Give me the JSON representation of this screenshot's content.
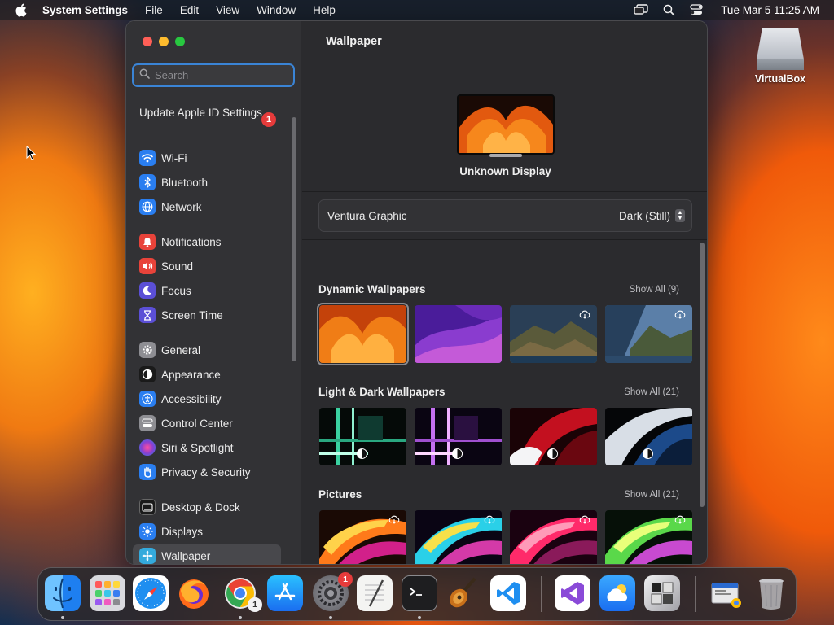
{
  "menubar": {
    "app_name": "System Settings",
    "menus": [
      "File",
      "Edit",
      "View",
      "Window",
      "Help"
    ],
    "clock": "Tue Mar 5  11:25 AM"
  },
  "desktop": {
    "icons": [
      {
        "label": "VirtualBox",
        "icon": "hard-drive-icon"
      }
    ]
  },
  "window": {
    "search": {
      "placeholder": "Search",
      "value": ""
    },
    "apple_id": {
      "label": "Update Apple ID Settings",
      "badge": "1"
    },
    "sidebar": {
      "items": [
        {
          "label": "Wi-Fi",
          "icon": "wifi-icon",
          "color": "#2a7ef0"
        },
        {
          "label": "Bluetooth",
          "icon": "bluetooth-icon",
          "color": "#2a7ef0"
        },
        {
          "label": "Network",
          "icon": "globe-icon",
          "color": "#2a7ef0"
        },
        {
          "label": "Notifications",
          "icon": "bell-icon",
          "color": "#e8433a"
        },
        {
          "label": "Sound",
          "icon": "speaker-icon",
          "color": "#e8433a"
        },
        {
          "label": "Focus",
          "icon": "moon-icon",
          "color": "#5b4fd6"
        },
        {
          "label": "Screen Time",
          "icon": "hourglass-icon",
          "color": "#5b4fd6"
        },
        {
          "label": "General",
          "icon": "gear-icon",
          "color": "#8e8e93"
        },
        {
          "label": "Appearance",
          "icon": "appearance-icon",
          "color": "#1a1a1a"
        },
        {
          "label": "Accessibility",
          "icon": "accessibility-icon",
          "color": "#2a7ef0"
        },
        {
          "label": "Control Center",
          "icon": "control-center-icon",
          "color": "#8e8e93"
        },
        {
          "label": "Siri & Spotlight",
          "icon": "siri-icon",
          "color": "#8a3fd0"
        },
        {
          "label": "Privacy & Security",
          "icon": "hand-icon",
          "color": "#2a7ef0"
        },
        {
          "label": "Desktop & Dock",
          "icon": "dock-icon",
          "color": "#1a1a1a"
        },
        {
          "label": "Displays",
          "icon": "sun-icon",
          "color": "#2a7ef0"
        },
        {
          "label": "Wallpaper",
          "icon": "wallpaper-icon",
          "color": "#34aadc",
          "selected": true
        }
      ]
    },
    "content": {
      "title": "Wallpaper",
      "display_name": "Unknown Display",
      "current_wallpaper": "Ventura Graphic",
      "appearance_mode": "Dark (Still)",
      "sections": [
        {
          "title": "Dynamic Wallpapers",
          "show_all": "Show All (9)"
        },
        {
          "title": "Light & Dark Wallpapers",
          "show_all": "Show All (21)"
        },
        {
          "title": "Pictures",
          "show_all": "Show All (21)"
        }
      ]
    }
  },
  "dock": {
    "apps": [
      {
        "name": "Finder",
        "icon": "finder-icon"
      },
      {
        "name": "Launchpad",
        "icon": "launchpad-icon"
      },
      {
        "name": "Safari",
        "icon": "safari-icon"
      },
      {
        "name": "Firefox",
        "icon": "firefox-icon"
      },
      {
        "name": "Chrome",
        "icon": "chrome-icon",
        "badge": "1"
      },
      {
        "name": "App Store",
        "icon": "app-store-icon"
      },
      {
        "name": "System Settings",
        "icon": "system-settings-icon",
        "badge": "1"
      },
      {
        "name": "TextEdit",
        "icon": "textedit-icon"
      },
      {
        "name": "Terminal",
        "icon": "terminal-icon"
      },
      {
        "name": "Instruments",
        "icon": "guitar-icon"
      },
      {
        "name": "Visual Studio Code",
        "icon": "vscode-icon"
      },
      {
        "name": "Visual Studio",
        "icon": "visual-studio-icon"
      },
      {
        "name": "OneDrive",
        "icon": "cloud-sun-icon"
      },
      {
        "name": "Utility",
        "icon": "utility-icon"
      },
      {
        "name": "Chrome Apps",
        "icon": "chrome-apps-folder-icon"
      },
      {
        "name": "Trash",
        "icon": "trash-icon"
      }
    ]
  }
}
